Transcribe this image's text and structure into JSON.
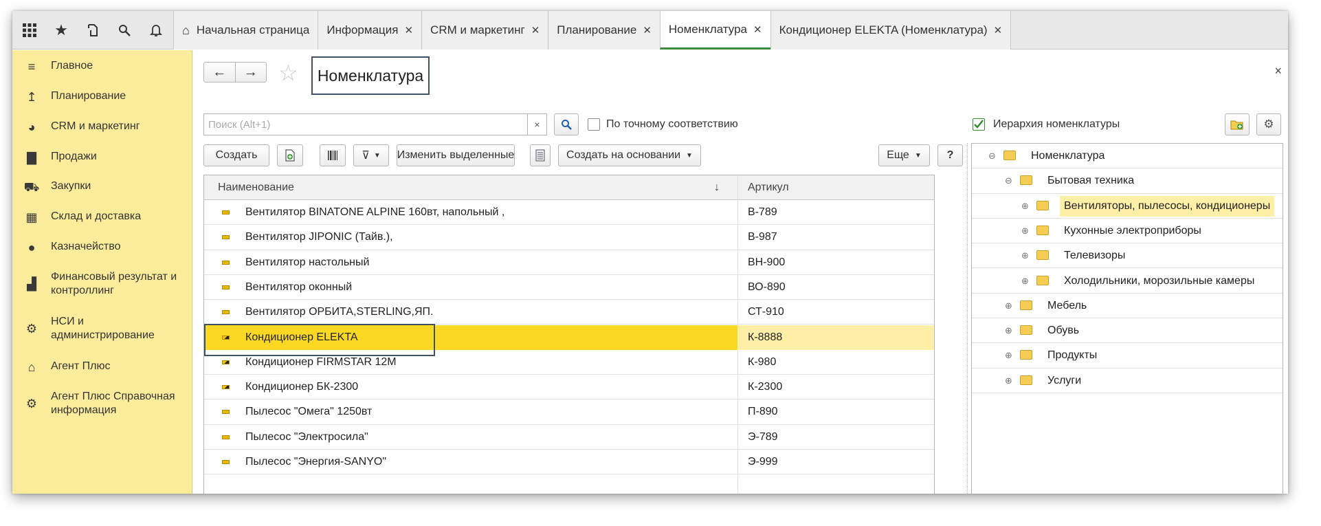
{
  "topbar": {
    "icons": [
      "apps-grid-icon",
      "favorites-star-icon",
      "history-icon",
      "search-icon",
      "notifications-bell-icon"
    ],
    "tabs": [
      {
        "label": "Начальная страница",
        "home": true,
        "closable": false
      },
      {
        "label": "Информация",
        "closable": true
      },
      {
        "label": "CRM и маркетинг",
        "closable": true
      },
      {
        "label": "Планирование",
        "closable": true
      },
      {
        "label": "Номенклатура",
        "closable": true,
        "active": true
      },
      {
        "label": "Кондиционер ELEKTA (Номенклатура)",
        "closable": true
      }
    ],
    "close_glyph": "✕"
  },
  "sidebar": {
    "items": [
      {
        "label": "Главное",
        "icon": "menu-lines-icon"
      },
      {
        "label": "Планирование",
        "icon": "planning-icon"
      },
      {
        "label": "CRM и маркетинг",
        "icon": "pie-chart-icon"
      },
      {
        "label": "Продажи",
        "icon": "shopping-bag-icon"
      },
      {
        "label": "Закупки",
        "icon": "cart-icon"
      },
      {
        "label": "Склад и доставка",
        "icon": "warehouse-icon"
      },
      {
        "label": "Казначейство",
        "icon": "ruble-icon"
      },
      {
        "label": "Финансовый результат и контроллинг",
        "icon": "bar-chart-icon"
      },
      {
        "label": "НСИ и администрирование",
        "icon": "gear-icon"
      },
      {
        "label": "Агент Плюс",
        "icon": "agent-icon"
      },
      {
        "label": "Агент Плюс Справочная информация",
        "icon": "agent-info-icon"
      }
    ]
  },
  "main": {
    "title": "Номенклатура",
    "search_placeholder": "Поиск (Alt+1)",
    "search_clear": "×",
    "exact_match_label": "По точному соответствию",
    "buttons": {
      "create": "Создать",
      "change_selected": "Изменить выделенные",
      "create_based_on": "Создать на основании",
      "more": "Еще",
      "help": "?"
    },
    "columns": {
      "name": "Наименование",
      "sort": "↓",
      "article": "Артикул"
    },
    "rows": [
      {
        "name": "Вентилятор BINATONE ALPINE 160вт, напольный ,",
        "article": "В-789",
        "half": false
      },
      {
        "name": "Вентилятор JIPONIC (Тайв.),",
        "article": "В-987",
        "half": false
      },
      {
        "name": "Вентилятор настольный",
        "article": "ВН-900",
        "half": false
      },
      {
        "name": "Вентилятор оконный",
        "article": "ВО-890",
        "half": false
      },
      {
        "name": "Вентилятор ОРБИТА,STERLING,ЯП.",
        "article": "СТ-910",
        "half": false
      },
      {
        "name": "Кондиционер ELEKTA",
        "article": "К-8888",
        "half": true,
        "selected": true
      },
      {
        "name": "Кондиционер FIRMSTAR 12M",
        "article": "К-980",
        "half": true
      },
      {
        "name": "Кондиционер БК-2300",
        "article": "К-2300",
        "half": true
      },
      {
        "name": "Пылесос \"Омега\" 1250вт",
        "article": "П-890",
        "half": false
      },
      {
        "name": "Пылесос \"Электросила\"",
        "article": "Э-789",
        "half": false
      },
      {
        "name": "Пылесос \"Энергия-SANYO\"",
        "article": "Э-999",
        "half": false
      }
    ],
    "close": "×"
  },
  "right": {
    "hierarchy_label": "Иерархия номенклатуры",
    "hierarchy_checked": true,
    "tree": [
      {
        "label": "Номенклатура",
        "level": 0,
        "toggle": "⊖"
      },
      {
        "label": "Бытовая техника",
        "level": 1,
        "toggle": "⊖"
      },
      {
        "label": "Вентиляторы, пылесосы, кондиционеры",
        "level": 2,
        "toggle": "⊕",
        "highlight": true
      },
      {
        "label": "Кухонные электроприборы",
        "level": 2,
        "toggle": "⊕"
      },
      {
        "label": "Телевизоры",
        "level": 2,
        "toggle": "⊕"
      },
      {
        "label": "Холодильники, морозильные камеры",
        "level": 2,
        "toggle": "⊕"
      },
      {
        "label": "Мебель",
        "level": 1,
        "toggle": "⊕"
      },
      {
        "label": "Обувь",
        "level": 1,
        "toggle": "⊕"
      },
      {
        "label": "Продукты",
        "level": 1,
        "toggle": "⊕"
      },
      {
        "label": "Услуги",
        "level": 1,
        "toggle": "⊕"
      }
    ]
  },
  "colors": {
    "sidebar_bg": "#fbec9b",
    "selection": "#fad824",
    "selection_light": "#fdf0a6",
    "active_tab": "#3a8a3a"
  }
}
